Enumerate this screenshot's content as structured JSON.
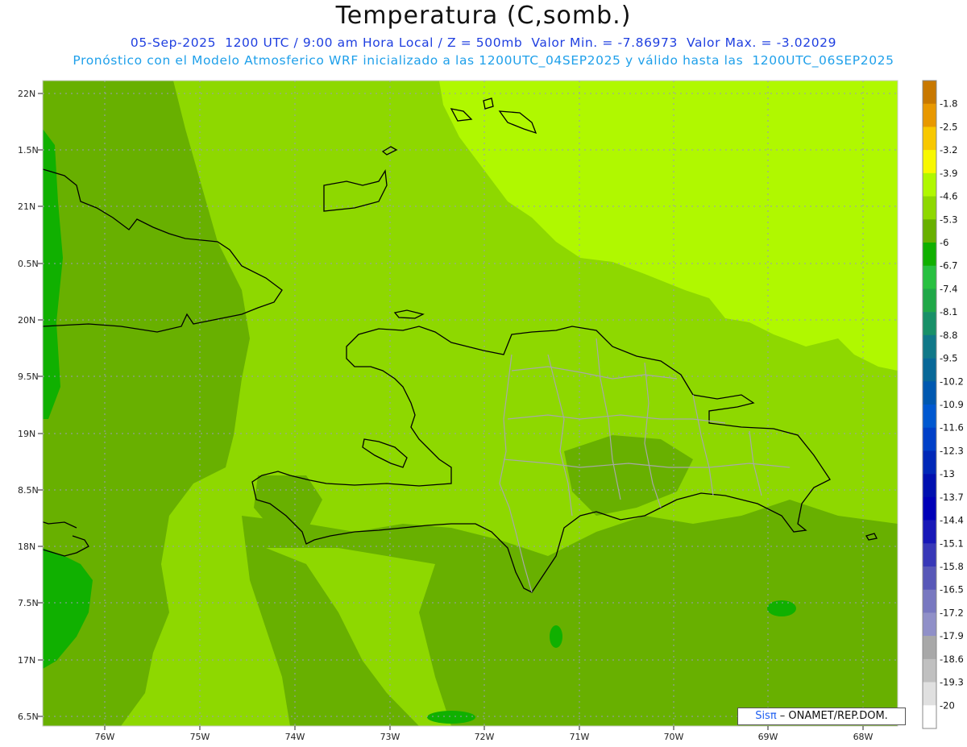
{
  "header": {
    "title": "Temperatura (C,somb.)",
    "line1": "05-Sep-2025  1200 UTC / 9:00 am Hora Local / Z = 500mb  Valor Min. = -7.86973  Valor Max. = -3.02029",
    "line2": "Pronóstico con el Modelo Atmosferico WRF inicializado a las 1200UTC_04SEP2025 y válido hasta las  1200UTC_06SEP2025"
  },
  "axes": {
    "lat_labels": [
      "22N",
      "1.5N",
      "21N",
      "0.5N",
      "20N",
      "9.5N",
      "19N",
      "8.5N",
      "18N",
      "7.5N",
      "17N",
      "6.5N"
    ],
    "lon_labels": [
      "76W",
      "75W",
      "74W",
      "73W",
      "72W",
      "71W",
      "70W",
      "69W",
      "68W"
    ]
  },
  "legend": {
    "labels": [
      "-1.8",
      "-2.5",
      "-3.2",
      "-3.9",
      "-4.6",
      "-5.3",
      "-6",
      "-6.7",
      "-7.4",
      "-8.1",
      "-8.8",
      "-9.5",
      "-10.2",
      "-10.9",
      "-11.6",
      "-12.3",
      "-13",
      "-13.7",
      "-14.4",
      "-15.1",
      "-15.8",
      "-16.5",
      "-17.2",
      "-17.9",
      "-18.6",
      "-19.3",
      "-20"
    ],
    "colors": [
      "#c87800",
      "#e89800",
      "#f8c800",
      "#f8f800",
      "#b0f800",
      "#8ed800",
      "#68b000",
      "#10b000",
      "#28c040",
      "#20a848",
      "#189068",
      "#107888",
      "#086898",
      "#0058b0",
      "#0058d0",
      "#0040c8",
      "#0028b8",
      "#0010b0",
      "#0000b8",
      "#1818b8",
      "#3838b8",
      "#5858b8",
      "#7878c0",
      "#9090c8",
      "#a8a8a8",
      "#c0c0c0",
      "#e0e0e0",
      "#ffffff"
    ]
  },
  "credit": {
    "brand": "Sisπ",
    "text": " – ONAMET/REP.DOM."
  },
  "palette": {
    "bright": "#b0f800",
    "mid": "#8ed800",
    "dark": "#68b000",
    "deep": "#10b000"
  }
}
